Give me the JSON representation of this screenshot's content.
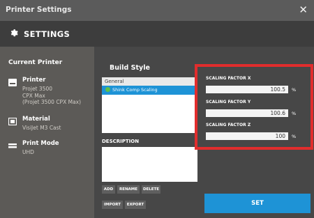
{
  "window": {
    "title": "Printer Settings",
    "close_glyph": "✕"
  },
  "header": {
    "title": "SETTINGS",
    "icon": "gear-icon"
  },
  "current_printer": {
    "title": "Current Printer",
    "printer": {
      "label": "Printer",
      "lines": [
        "Projet 3500",
        "CPX Max",
        "(Projet 3500 CPX Max)"
      ],
      "icon": "printer-icon"
    },
    "material": {
      "label": "Material",
      "value": "VisiJet M3 Cast",
      "icon": "material-icon"
    },
    "print_mode": {
      "label": "Print Mode",
      "value": "UHD",
      "icon": "print-mode-icon"
    }
  },
  "build_style": {
    "title": "Build Style",
    "items": [
      {
        "label": "General",
        "selected": false
      },
      {
        "label": "Shink Comp Scaling",
        "selected": true
      }
    ]
  },
  "description": {
    "label": "DESCRIPTION",
    "value": ""
  },
  "buttons": {
    "add": "ADD",
    "rename": "RENAME",
    "delete": "DELETE",
    "import": "IMPORT",
    "export": "EXPORT",
    "set": "SET"
  },
  "scaling": {
    "x": {
      "label": "SCALING FACTOR X",
      "value": "100.5",
      "unit": "%"
    },
    "y": {
      "label": "SCALING FACTOR Y",
      "value": "100.6",
      "unit": "%"
    },
    "z": {
      "label": "SCALING FACTOR Z",
      "value": "100",
      "unit": "%"
    }
  },
  "colors": {
    "accent": "#1e93d6",
    "highlight": "#e12d2d",
    "status_dot": "#5cc04a"
  }
}
